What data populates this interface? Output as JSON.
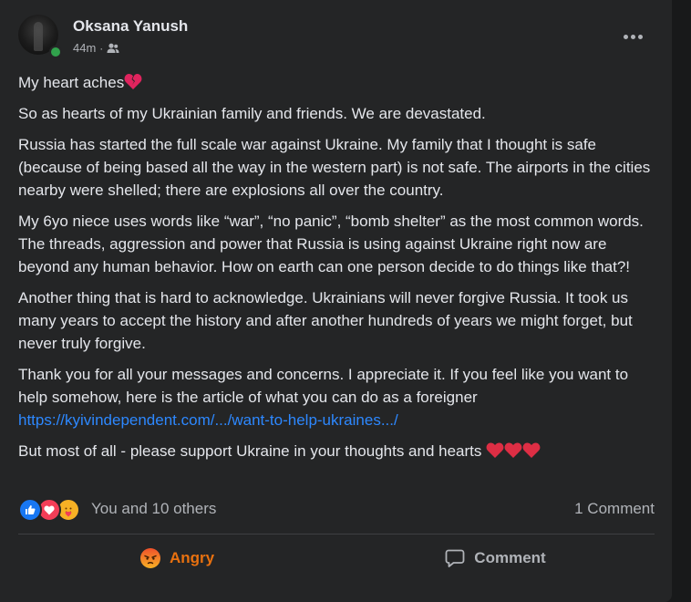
{
  "post": {
    "author": "Oksana Yanush",
    "time": "44m",
    "separator": "·",
    "audience_icon": "friends-icon",
    "paragraphs": {
      "p1": "My heart aches",
      "p2": "So as hearts of my Ukrainian family and friends. We are devastated.",
      "p3": "Russia has started the full scale war against Ukraine. My family that I thought is safe (because of being based all the way in the western part) is not safe. The airports in the cities nearby were shelled; there are explosions all over the country.",
      "p4": "My 6yo niece uses words like “war”, “no panic”, “bomb shelter” as the most common words. The threads, aggression and power that Russia is using against Ukraine right now are beyond any human behavior. How on earth can one person decide to do things like that?!",
      "p5": "Another thing that is hard to acknowledge. Ukrainians will never forgive Russia. It took us many years to accept the history and after another hundreds of years we might forget, but never truly forgive.",
      "p6": "Thank you for all your messages and concerns. I appreciate it. If you feel like you want to help somehow, here is the article of what you can do as a foreigner",
      "p6_link": "https://kyivindependent.com/.../want-to-help-ukraines.../",
      "p7": "But most of all - please support Ukraine in your thoughts and hearts"
    },
    "emojis": {
      "broken_heart": "broken-heart-icon",
      "flag": "ukraine-flag-icon",
      "red_heart": "red-heart-icon"
    }
  },
  "stats": {
    "reaction_icons": [
      "like-icon",
      "love-icon",
      "care-icon"
    ],
    "reactors": "You and 10 others",
    "comments": "1 Comment"
  },
  "actions": {
    "angry_label": "Angry",
    "comment_label": "Comment"
  },
  "colors": {
    "background": "#18191a",
    "card": "#242526",
    "text": "#e4e6eb",
    "secondary_text": "#b0b3b8",
    "link": "#2d88ff",
    "angry": "#e9710f",
    "online": "#31a24c"
  }
}
